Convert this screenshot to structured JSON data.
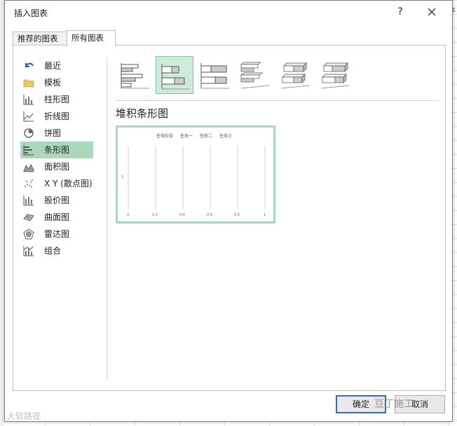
{
  "dialog": {
    "title": "插入图表",
    "help_label": "?",
    "tabs": [
      {
        "label": "推荐的图表",
        "selected": false
      },
      {
        "label": "所有图表",
        "selected": true
      }
    ],
    "sidebar": {
      "items": [
        {
          "label": "最近",
          "icon": "undo-icon"
        },
        {
          "label": "模板",
          "icon": "folder-icon"
        },
        {
          "label": "柱形图",
          "icon": "column-chart-icon"
        },
        {
          "label": "折线图",
          "icon": "line-chart-icon"
        },
        {
          "label": "饼图",
          "icon": "pie-chart-icon"
        },
        {
          "label": "条形图",
          "icon": "bar-chart-icon",
          "selected": true
        },
        {
          "label": "面积图",
          "icon": "area-chart-icon"
        },
        {
          "label": "X Y (散点图)",
          "icon": "scatter-chart-icon"
        },
        {
          "label": "股价图",
          "icon": "stock-chart-icon"
        },
        {
          "label": "曲面图",
          "icon": "surface-chart-icon"
        },
        {
          "label": "雷达图",
          "icon": "radar-chart-icon"
        },
        {
          "label": "组合",
          "icon": "combo-chart-icon"
        }
      ]
    },
    "subtypes": [
      {
        "icon": "clustered-bar-icon",
        "selected": false
      },
      {
        "icon": "stacked-bar-icon",
        "selected": true
      },
      {
        "icon": "100-stacked-bar-icon",
        "selected": false
      },
      {
        "icon": "3d-clustered-bar-icon",
        "selected": false
      },
      {
        "icon": "3d-stacked-bar-icon",
        "selected": false
      },
      {
        "icon": "3d-100-stacked-bar-icon",
        "selected": false
      }
    ],
    "selected_chart_name": "堆积条形图",
    "preview": {
      "legend": [
        "任务阶段",
        "任务一",
        "任务二",
        "任务三"
      ],
      "category_label": "1",
      "x_ticks": [
        "0",
        "0.2",
        "0.4",
        "0.6",
        "0.8",
        "1"
      ]
    },
    "buttons": {
      "ok": "确定",
      "cancel": "取消"
    },
    "accent_color": "#a9d8bd"
  },
  "background": {
    "corner_text": "本"
  },
  "watermarks": {
    "left": "大软路提",
    "right": "豆丁施工"
  }
}
